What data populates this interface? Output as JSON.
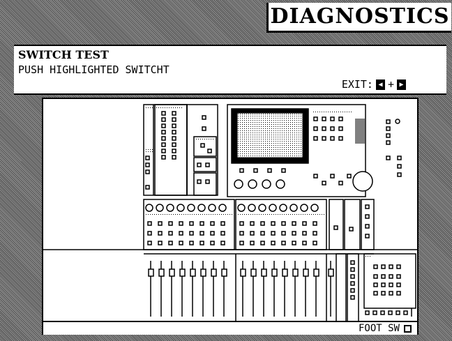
{
  "header": {
    "title": "DIAGNOSTICS"
  },
  "panel": {
    "title": "SWITCH TEST",
    "instruction": "PUSH HIGHLIGHTED SWITCHT",
    "exit_label": "EXIT:",
    "exit_left_icon": "left-arrow-key-icon",
    "exit_plus": "+",
    "exit_right_icon": "right-arrow-key-icon"
  },
  "console": {
    "display_color": "#000000",
    "footer_label": "FOOT SW"
  }
}
